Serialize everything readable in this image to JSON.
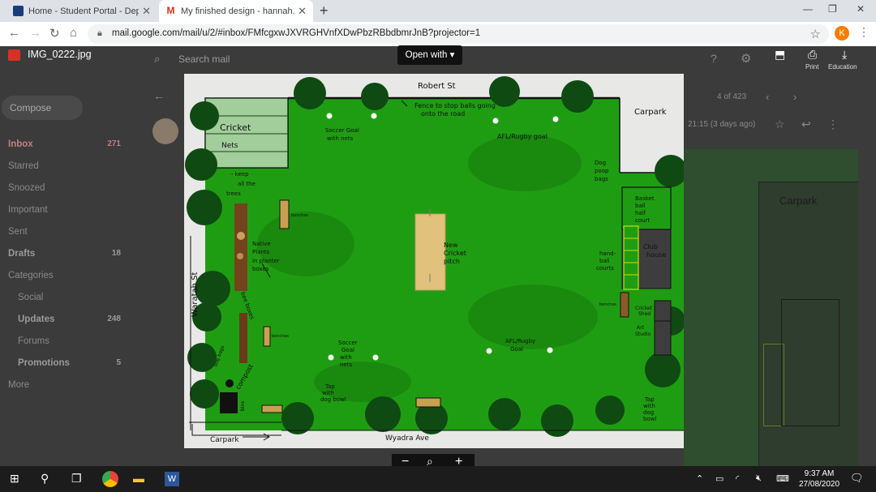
{
  "browser": {
    "tabs": [
      {
        "title": "Home - Student Portal - Departm",
        "active": false,
        "favicon_color": "#1a3d7a"
      },
      {
        "title": "My finished design - hannah.mo",
        "active": true,
        "favicon_color": "#d93025"
      }
    ],
    "new_tab": "+",
    "url": "mail.google.com/mail/u/2/#inbox/FMfcgxwJXVRGHVnfXDwPbzRBbdbmrJnB?projector=1",
    "profile_initial": "K"
  },
  "gmail": {
    "search_placeholder": "Search mail",
    "compose": "Compose",
    "nav": [
      {
        "label": "Inbox",
        "count": "271"
      },
      {
        "label": "Starred",
        "count": ""
      },
      {
        "label": "Snoozed",
        "count": ""
      },
      {
        "label": "Important",
        "count": ""
      },
      {
        "label": "Sent",
        "count": ""
      },
      {
        "label": "Drafts",
        "count": "18"
      },
      {
        "label": "Categories",
        "count": ""
      },
      {
        "label": "Social",
        "count": ""
      },
      {
        "label": "Updates",
        "count": "248"
      },
      {
        "label": "Forums",
        "count": ""
      },
      {
        "label": "Promotions",
        "count": "5"
      },
      {
        "label": "More",
        "count": ""
      }
    ],
    "pager": "4 of 423",
    "timestamp": "21:15 (3 days ago)"
  },
  "viewer": {
    "filename": "IMG_0222.jpg",
    "open_with": "Open with",
    "actions": [
      "Print",
      "Download"
    ],
    "action_labels": [
      "Print",
      "Education"
    ],
    "zoom_out": "−",
    "zoom_in": "+"
  },
  "drawing": {
    "labels": {
      "robert_st": "Robert St",
      "fence": "Fence to stop balls going",
      "fence2": "onto the road",
      "carpark_top": "Carpark",
      "cricket_nets1": "Cricket",
      "cricket_nets2": "Nets",
      "soccer_goal_top1": "Soccer Goal",
      "soccer_goal_top2": "with nets",
      "afl_top": "AFL/Rugby goal",
      "keep_trees1": "- keep",
      "keep_trees2": "all the",
      "keep_trees3": "trees",
      "dog_poop1": "Dog",
      "dog_poop2": "poop",
      "dog_poop3": "bags",
      "basketball1": "Basket",
      "basketball2": "ball",
      "basketball3": "half",
      "basketball4": "court",
      "benches_top": "benches",
      "native1": "Native",
      "native2": "Plants",
      "native3": "in planter",
      "native4": "boxes",
      "pitch1": "New",
      "pitch2": "Cricket",
      "pitch3": "pitch",
      "handball1": "hand-",
      "handball2": "ball",
      "handball3": "courts",
      "clubhouse1": "Club",
      "clubhouse2": "house",
      "waratah": "Waratah St",
      "bee_boxes": "bee boxes",
      "benches_mid": "benches",
      "cricket_shed1": "Cricket",
      "cricket_shed2": "Shed",
      "art_studio1": "Art",
      "art_studio2": "Studio",
      "soccer_goal_bot1": "Soccer",
      "soccer_goal_bot2": "Goal",
      "soccer_goal_bot3": "with",
      "soccer_goal_bot4": "nets",
      "afl_bot1": "AFL/Rugby",
      "afl_bot2": "Goal",
      "dog_bags_left": "dog bags",
      "compost": "compost",
      "tap_left1": "Tap",
      "tap_left2": "with",
      "tap_left3": "dog bowl",
      "bins": "bins",
      "tap_right1": "Tap",
      "tap_right2": "with",
      "tap_right3": "dog",
      "tap_right4": "bowl",
      "carpark_bottom": "Carpark",
      "wyadra": "Wyadra Ave",
      "bench_label": "benches"
    }
  },
  "taskbar": {
    "time": "9:37 AM",
    "date": "27/08/2020"
  },
  "colors": {
    "grass": "#1f9d12",
    "grass_dark": "#157a0c",
    "tree": "#0f4a12",
    "pitch": "#e0c27c",
    "accent": "#1a73e8"
  }
}
